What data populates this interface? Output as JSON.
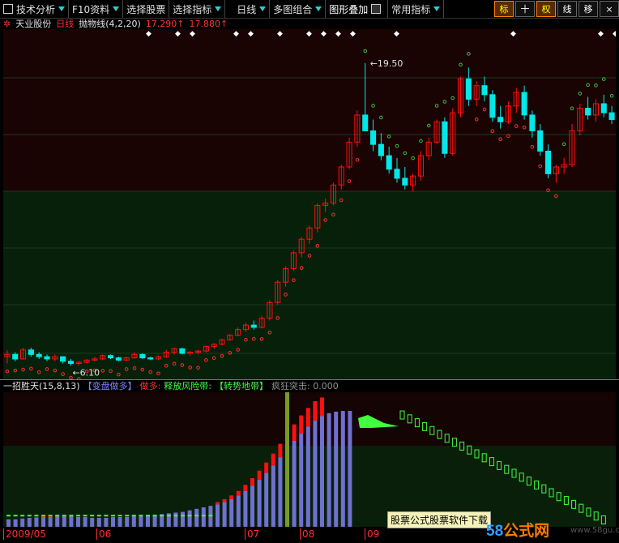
{
  "toolbar": {
    "items": [
      {
        "label": "技术分析"
      },
      {
        "label": "F10资料"
      },
      {
        "label": "选择股票"
      },
      {
        "label": "选择指标"
      },
      {
        "label": "日线"
      },
      {
        "label": "多图组合"
      },
      {
        "label": "图形叠加"
      },
      {
        "label": "常用指标"
      }
    ],
    "right_buttons": [
      "标",
      "十",
      "权",
      "线",
      "移",
      "×"
    ]
  },
  "header": {
    "stock": "天业股份",
    "period": "日线",
    "indicator": "抛物线(4,2,20)",
    "value1": "17.290↑",
    "value2": "17.880↑",
    "high_label": "19.50",
    "low_label": "6.10"
  },
  "sub": {
    "name": "一招胜天(15,8,13)",
    "tag1": "【变盘做多】",
    "tag2": "做多:",
    "tag3": "释放风险带:",
    "tag4": "【转势地带】",
    "tag5": "疯狂突击: 0.000"
  },
  "xaxis": {
    "labels": [
      "2009/05",
      "06",
      "07",
      "08",
      "09"
    ]
  },
  "watermark": "股票公式股票软件下载",
  "brand": {
    "num": "58",
    "cn": "公式网",
    "url": "www.58gu.com"
  },
  "colors": {
    "up": "#ff1010",
    "down": "#00e8e8",
    "sar_up": "#ff3030",
    "sar_down": "#40c040",
    "bar_purple": "#7070d0",
    "bar_green": "#40ff40",
    "bg_green": "#0a2a0a"
  },
  "chart_data": {
    "type": "candlestick",
    "ylim": [
      5.5,
      21.0
    ],
    "candles": [
      [
        6.5,
        6.8,
        6.2,
        6.6
      ],
      [
        6.6,
        6.7,
        6.3,
        6.4
      ],
      [
        6.4,
        6.9,
        6.4,
        6.8
      ],
      [
        6.8,
        6.9,
        6.5,
        6.6
      ],
      [
        6.6,
        6.7,
        6.4,
        6.5
      ],
      [
        6.5,
        6.6,
        6.3,
        6.4
      ],
      [
        6.4,
        6.6,
        6.3,
        6.5
      ],
      [
        6.5,
        6.5,
        6.2,
        6.3
      ],
      [
        6.3,
        6.4,
        6.1,
        6.2
      ],
      [
        6.2,
        6.3,
        6.1,
        6.25
      ],
      [
        6.25,
        6.4,
        6.2,
        6.35
      ],
      [
        6.35,
        6.5,
        6.3,
        6.4
      ],
      [
        6.4,
        6.6,
        6.35,
        6.55
      ],
      [
        6.55,
        6.6,
        6.4,
        6.45
      ],
      [
        6.45,
        6.5,
        6.3,
        6.35
      ],
      [
        6.35,
        6.5,
        6.3,
        6.45
      ],
      [
        6.45,
        6.7,
        6.4,
        6.6
      ],
      [
        6.6,
        6.65,
        6.4,
        6.45
      ],
      [
        6.45,
        6.5,
        6.35,
        6.4
      ],
      [
        6.4,
        6.55,
        6.35,
        6.5
      ],
      [
        6.5,
        6.8,
        6.45,
        6.7
      ],
      [
        6.7,
        6.9,
        6.6,
        6.85
      ],
      [
        6.85,
        6.9,
        6.6,
        6.65
      ],
      [
        6.65,
        6.75,
        6.55,
        6.7
      ],
      [
        6.7,
        6.8,
        6.6,
        6.75
      ],
      [
        6.75,
        7.0,
        6.7,
        6.95
      ],
      [
        6.95,
        7.1,
        6.85,
        7.05
      ],
      [
        7.05,
        7.3,
        7.0,
        7.25
      ],
      [
        7.25,
        7.5,
        7.2,
        7.45
      ],
      [
        7.45,
        7.8,
        7.4,
        7.7
      ],
      [
        7.7,
        8.0,
        7.6,
        7.9
      ],
      [
        7.9,
        8.1,
        7.7,
        7.8
      ],
      [
        7.8,
        8.3,
        7.75,
        8.2
      ],
      [
        8.2,
        9.0,
        8.1,
        8.9
      ],
      [
        8.9,
        9.9,
        8.8,
        9.8
      ],
      [
        9.8,
        10.5,
        9.6,
        10.4
      ],
      [
        10.4,
        11.2,
        10.3,
        11.1
      ],
      [
        11.1,
        11.8,
        10.9,
        11.7
      ],
      [
        11.7,
        12.3,
        11.5,
        12.2
      ],
      [
        12.2,
        13.3,
        12.0,
        13.2
      ],
      [
        13.2,
        13.5,
        12.9,
        13.3
      ],
      [
        13.3,
        14.2,
        13.2,
        14.1
      ],
      [
        14.1,
        15.0,
        13.9,
        14.9
      ],
      [
        14.9,
        16.2,
        14.8,
        16.0
      ],
      [
        16.0,
        17.4,
        15.8,
        17.2
      ],
      [
        17.2,
        19.5,
        16.8,
        16.5
      ],
      [
        16.5,
        17.0,
        15.6,
        15.9
      ],
      [
        15.9,
        16.4,
        15.2,
        15.4
      ],
      [
        15.4,
        15.8,
        14.6,
        14.8
      ],
      [
        14.8,
        15.3,
        14.2,
        14.4
      ],
      [
        14.4,
        14.9,
        13.9,
        14.1
      ],
      [
        14.1,
        14.6,
        13.8,
        14.5
      ],
      [
        14.5,
        15.6,
        14.3,
        15.4
      ],
      [
        15.4,
        16.2,
        15.2,
        16.0
      ],
      [
        16.0,
        17.0,
        15.9,
        16.9
      ],
      [
        16.9,
        17.1,
        15.3,
        15.5
      ],
      [
        15.5,
        17.5,
        15.4,
        17.3
      ],
      [
        17.3,
        18.9,
        17.1,
        18.8
      ],
      [
        18.8,
        19.3,
        17.6,
        17.9
      ],
      [
        17.9,
        18.7,
        17.6,
        18.5
      ],
      [
        18.5,
        18.9,
        17.8,
        18.1
      ],
      [
        18.1,
        18.3,
        16.9,
        17.1
      ],
      [
        17.1,
        17.6,
        16.6,
        16.9
      ],
      [
        16.9,
        17.8,
        16.8,
        17.6
      ],
      [
        17.6,
        18.4,
        17.3,
        18.2
      ],
      [
        18.2,
        18.5,
        17.0,
        17.2
      ],
      [
        17.2,
        17.4,
        16.2,
        16.5
      ],
      [
        16.5,
        16.8,
        15.4,
        15.6
      ],
      [
        15.6,
        15.9,
        14.4,
        14.6
      ],
      [
        14.6,
        15.0,
        14.2,
        14.9
      ],
      [
        14.9,
        15.3,
        14.6,
        15.0
      ],
      [
        15.0,
        16.8,
        14.9,
        16.5
      ],
      [
        16.5,
        17.7,
        16.3,
        17.5
      ],
      [
        17.5,
        18.0,
        17.0,
        17.2
      ],
      [
        17.2,
        17.9,
        16.9,
        17.7
      ],
      [
        17.7,
        18.1,
        17.1,
        17.3
      ],
      [
        17.3,
        17.6,
        16.8,
        17.0
      ]
    ],
    "osc": [
      [
        1.0,
        0
      ],
      [
        1.0,
        0
      ],
      [
        1.1,
        0
      ],
      [
        1.2,
        0
      ],
      [
        1.2,
        0.1
      ],
      [
        1.3,
        0.1
      ],
      [
        1.3,
        0.2
      ],
      [
        1.4,
        0.2
      ],
      [
        1.4,
        0.1
      ],
      [
        1.4,
        0
      ],
      [
        1.3,
        0
      ],
      [
        1.3,
        0
      ],
      [
        1.2,
        0
      ],
      [
        1.2,
        0
      ],
      [
        1.2,
        0
      ],
      [
        1.3,
        0
      ],
      [
        1.3,
        0
      ],
      [
        1.3,
        0
      ],
      [
        1.4,
        0
      ],
      [
        1.4,
        0
      ],
      [
        1.5,
        0
      ],
      [
        1.6,
        0
      ],
      [
        1.7,
        0
      ],
      [
        1.8,
        0
      ],
      [
        1.9,
        0
      ],
      [
        2.0,
        0
      ],
      [
        2.2,
        0
      ],
      [
        2.4,
        0
      ],
      [
        2.6,
        0
      ],
      [
        2.8,
        0
      ],
      [
        3.0,
        0.3
      ],
      [
        3.3,
        0.4
      ],
      [
        3.7,
        0.5
      ],
      [
        4.2,
        0.6
      ],
      [
        4.8,
        0.8
      ],
      [
        5.5,
        1.0
      ],
      [
        6.3,
        1.2
      ],
      [
        7.2,
        1.4
      ],
      [
        8.2,
        1.6
      ],
      [
        9.3,
        1.8
      ],
      [
        10.4,
        2.0
      ],
      [
        11.5,
        2.2
      ],
      [
        12.5,
        2.4
      ],
      [
        13.4,
        2.5
      ],
      [
        14.2,
        2.6
      ],
      [
        14.8,
        2.5
      ],
      [
        15.2,
        0
      ],
      [
        15.4,
        0
      ],
      [
        15.5,
        0
      ],
      [
        15.5,
        0
      ]
    ]
  }
}
